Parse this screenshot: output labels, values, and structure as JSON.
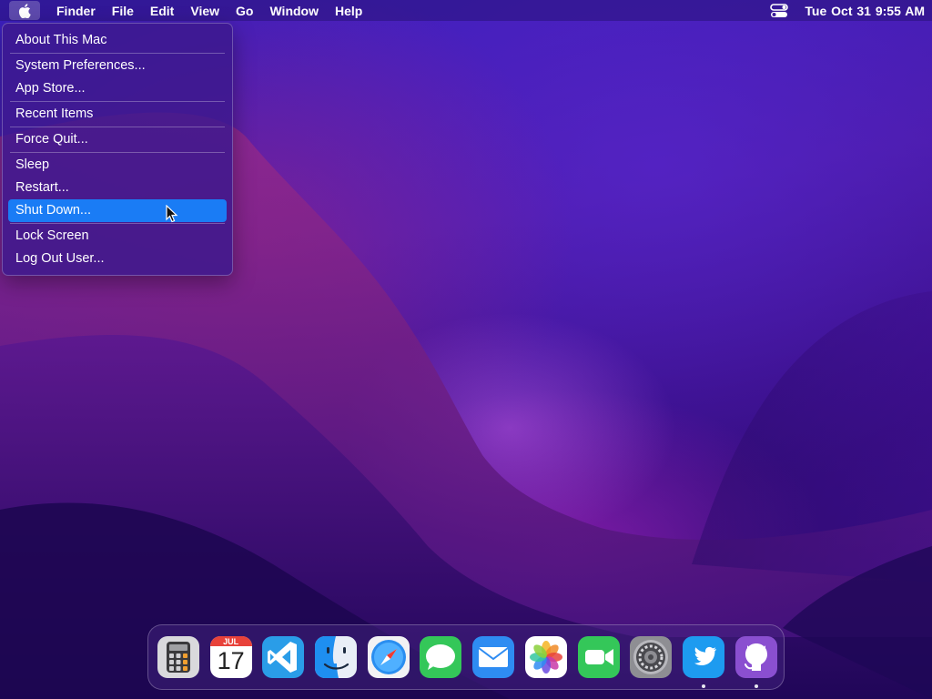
{
  "menubar": {
    "apple_icon": "apple-logo-icon",
    "app_name": "Finder",
    "menus": [
      "File",
      "Edit",
      "View",
      "Go",
      "Window",
      "Help"
    ],
    "control_center_icon": "control-center-icon",
    "clock": "Tue Oct 31  9:55 AM"
  },
  "apple_menu": {
    "items": [
      {
        "label": "About This Mac"
      },
      {
        "label": "System Preferences..."
      },
      {
        "label": "App Store..."
      },
      {
        "label": "Recent Items"
      },
      {
        "label": "Force Quit..."
      },
      {
        "label": "Sleep"
      },
      {
        "label": "Restart..."
      },
      {
        "label": "Shut Down...",
        "highlighted": true
      },
      {
        "label": "Lock Screen"
      },
      {
        "label": "Log Out User..."
      }
    ],
    "highlight_color": "#1a7cf5"
  },
  "dock": {
    "calendar": {
      "month": "JUL",
      "day": "17"
    },
    "apps": [
      {
        "name": "calculator-icon",
        "running": false
      },
      {
        "name": "calendar-icon",
        "running": false
      },
      {
        "name": "vscode-icon",
        "running": false
      },
      {
        "name": "finder-icon",
        "running": false
      },
      {
        "name": "safari-icon",
        "running": false
      },
      {
        "name": "messages-icon",
        "running": false
      },
      {
        "name": "mail-icon",
        "running": false
      },
      {
        "name": "photos-icon",
        "running": false
      },
      {
        "name": "facetime-icon",
        "running": false
      },
      {
        "name": "system-preferences-icon",
        "running": false
      },
      {
        "name": "twitter-icon",
        "running": true
      },
      {
        "name": "github-icon",
        "running": true
      }
    ]
  }
}
